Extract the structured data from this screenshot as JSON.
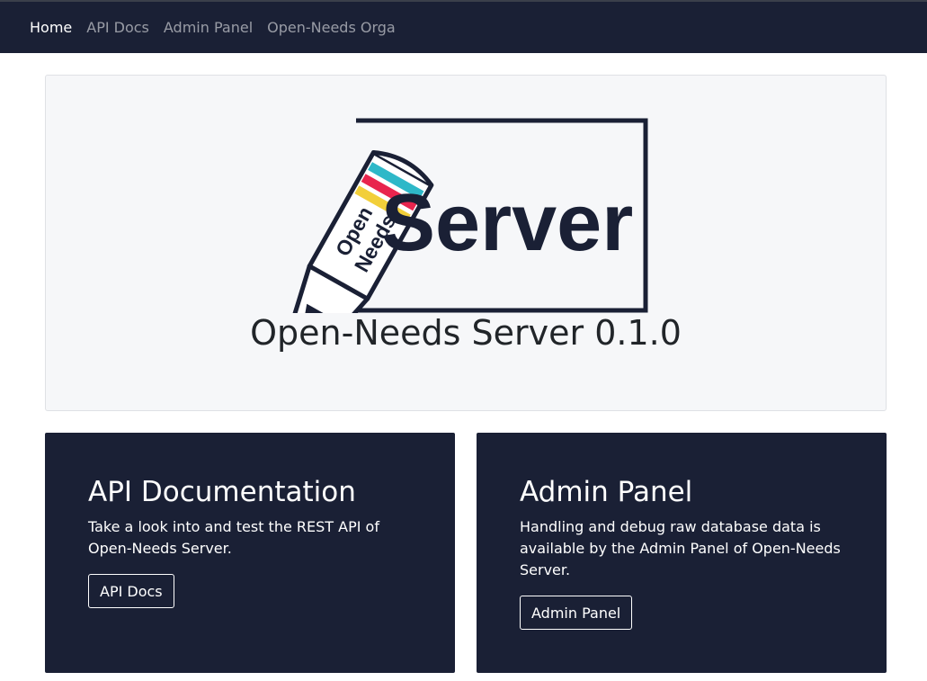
{
  "nav": {
    "items": [
      {
        "label": "Home",
        "active": true
      },
      {
        "label": "API Docs",
        "active": false
      },
      {
        "label": "Admin Panel",
        "active": false
      },
      {
        "label": "Open-Needs Orga",
        "active": false
      }
    ]
  },
  "hero": {
    "title": "Open-Needs Server 0.1.0"
  },
  "logo": {
    "text": [
      "Open",
      "Needs",
      "Server"
    ],
    "stripe_colors": [
      "#2eb8c8",
      "#e8254e",
      "#f2cf3a"
    ],
    "ink_color": "#1a2035"
  },
  "cards": {
    "api": {
      "title": "API Documentation",
      "text": "Take a look into and test the REST API of Open-Needs Server.",
      "button": "API Docs"
    },
    "admin": {
      "title": "Admin Panel",
      "text": "Handling and debug raw database data is available by the Admin Panel of Open-Needs Server.",
      "button": "Admin Panel"
    }
  },
  "colors": {
    "navbar_bg": "#1a2035",
    "hero_bg": "#f6f7f9",
    "card_bg": "#1a2035"
  }
}
